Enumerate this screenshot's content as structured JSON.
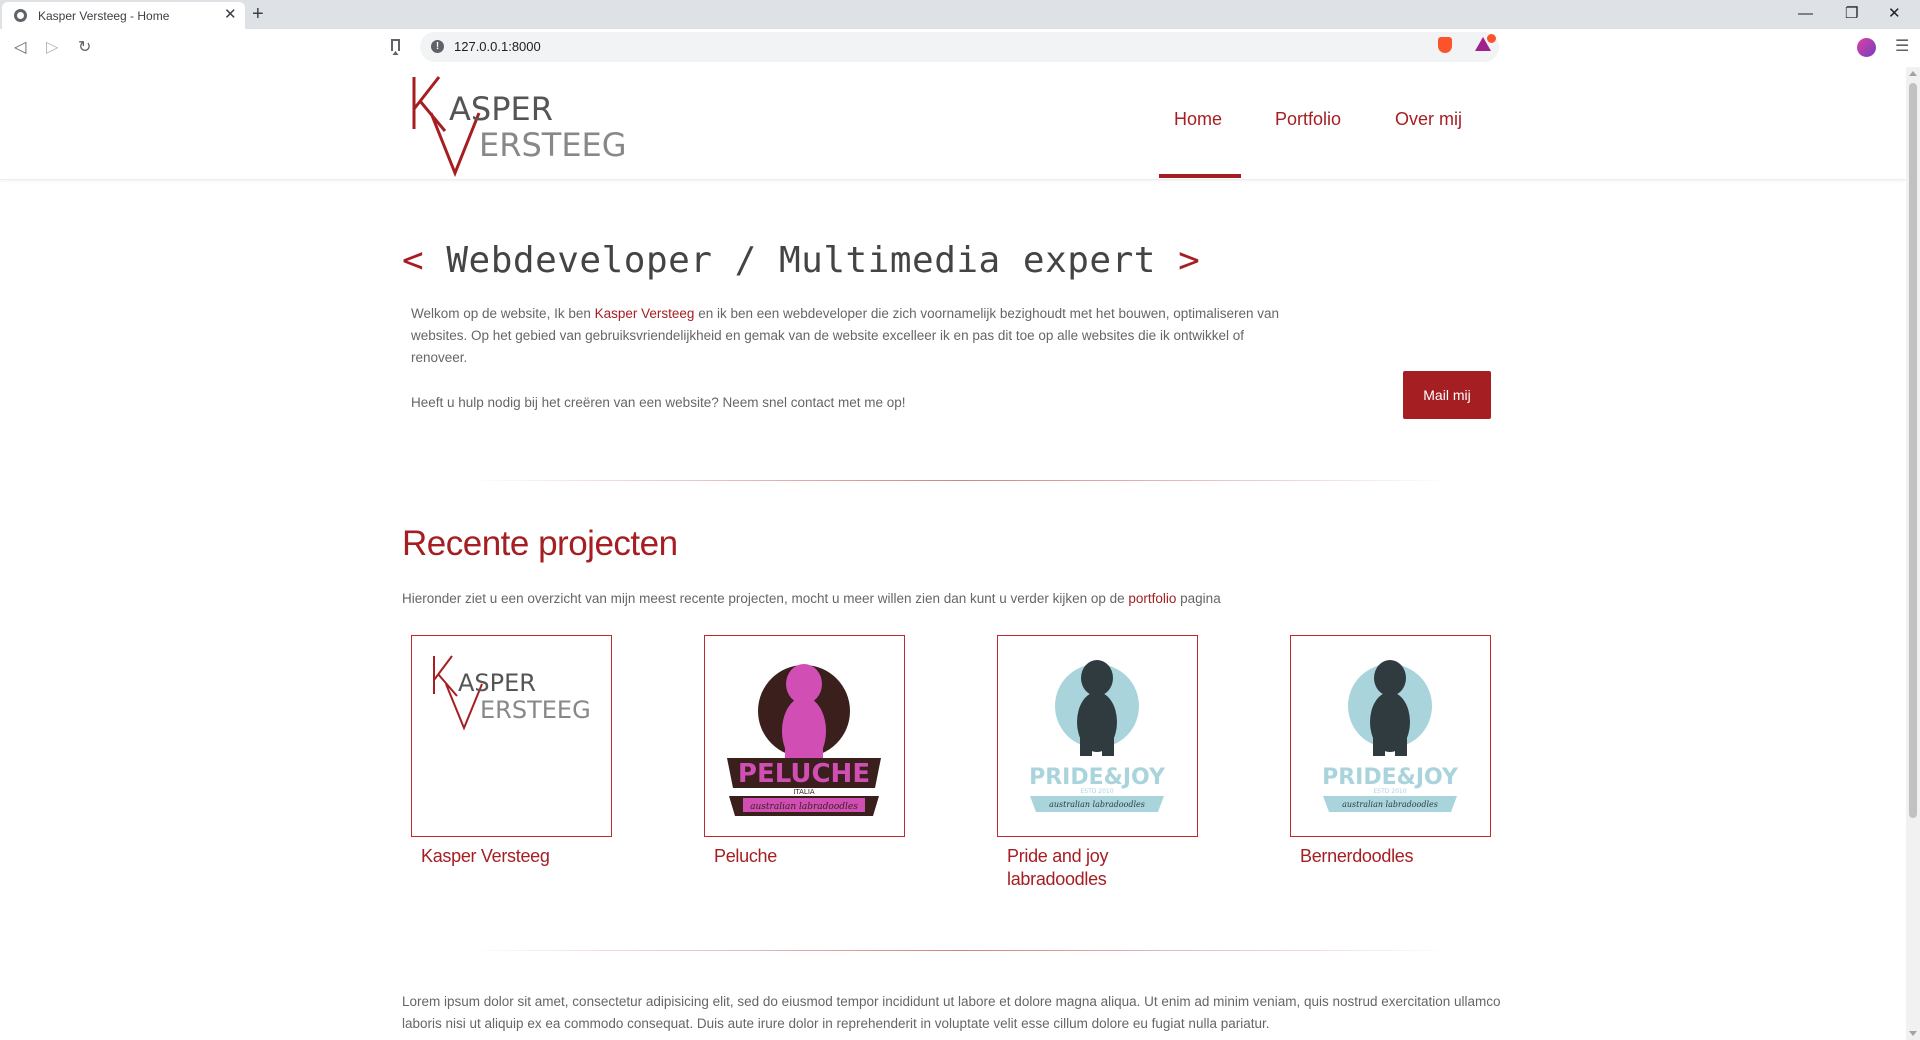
{
  "browser": {
    "tab_title": "Kasper Versteeg - Home",
    "tab_close": "✕",
    "new_tab": "+",
    "url": "127.0.0.1:8000",
    "window_controls": {
      "minimize": "—",
      "restore": "❐",
      "close": "✕"
    }
  },
  "header": {
    "logo": {
      "line1": "ASPER",
      "line2": "ERSTEEG",
      "big1": "K",
      "big2": "V"
    },
    "nav": [
      {
        "label": "Home",
        "active": true
      },
      {
        "label": "Portfolio",
        "active": false
      },
      {
        "label": "Over mij",
        "active": false
      }
    ]
  },
  "hero": {
    "bracket_open": "<",
    "title": "Webdeveloper / Multimedia expert",
    "bracket_close": ">",
    "intro_before": "Welkom op de website, Ik ben ",
    "intro_name": "Kasper Versteeg",
    "intro_after": " en ik ben een webdeveloper die zich voornamelijk bezighoudt met het bouwen, optimaliseren van websites. Op het gebied van gebruiksvriendelijkheid en gemak van de website excelleer ik en pas dit toe op alle websites die ik ontwikkel of renoveer.",
    "cta": "Heeft u hulp nodig bij het creëren van een website? Neem snel contact met me op!",
    "mail_button": "Mail mij"
  },
  "projects": {
    "title": "Recente projecten",
    "subtitle_before": "Hieronder ziet u een overzicht van mijn meest recente projecten, mocht u meer willen zien dan kunt u verder kijken op de ",
    "subtitle_link": "portfolio",
    "subtitle_after": " pagina",
    "items": [
      {
        "name": "Kasper Versteeg",
        "logo": "kasper-versteeg-logo"
      },
      {
        "name": "Peluche",
        "logo": "peluche-logo",
        "logo_text": "PELUCHE",
        "logo_small": "ITALIA",
        "logo_banner": "australian labradoodles"
      },
      {
        "name": "Pride and joy labradoodles",
        "logo": "pride-and-joy-logo",
        "logo_text": "PRIDE&JOY",
        "logo_small": "ESTD 2010",
        "logo_banner": "australian labradoodles"
      },
      {
        "name": "Bernerdoodles",
        "logo": "pride-and-joy-logo",
        "logo_text": "PRIDE&JOY",
        "logo_small": "ESTD 2010",
        "logo_banner": "australian labradoodles"
      }
    ]
  },
  "footer_text": "Lorem ipsum dolor sit amet, consectetur adipisicing elit, sed do eiusmod tempor incididunt ut labore et dolore magna aliqua. Ut enim ad minim veniam, quis nostrud exercitation ullamco laboris nisi ut aliquip ex ea commodo consequat. Duis aute irure dolor in reprehenderit in voluptate velit esse cillum dolore eu fugiat nulla pariatur.",
  "colors": {
    "accent": "#a51e22",
    "text": "#666666",
    "heading": "#444444"
  }
}
